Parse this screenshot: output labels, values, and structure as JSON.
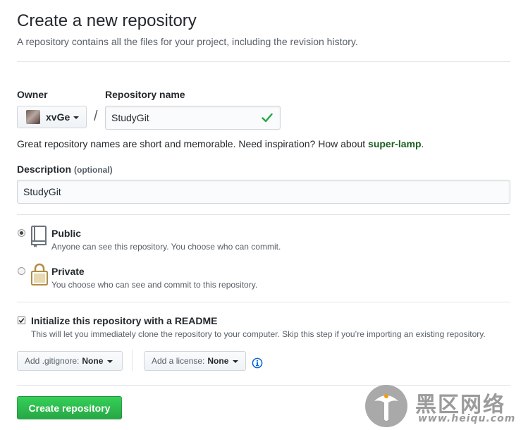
{
  "header": {
    "title": "Create a new repository",
    "subtitle": "A repository contains all the files for your project, including the revision history."
  },
  "owner": {
    "label": "Owner",
    "name": "xvGe"
  },
  "separator": "/",
  "repo_name": {
    "label": "Repository name",
    "value": "StudyGit",
    "valid": true
  },
  "hint": {
    "prefix": "Great repository names are short and memorable. Need inspiration? How about ",
    "suggestion": "super-lamp",
    "suffix": "."
  },
  "description": {
    "label": "Description",
    "optional": "(optional)",
    "value": "StudyGit"
  },
  "visibility": {
    "selected": "public",
    "public": {
      "title": "Public",
      "desc": "Anyone can see this repository. You choose who can commit."
    },
    "private": {
      "title": "Private",
      "desc": "You choose who can see and commit to this repository."
    }
  },
  "readme": {
    "checked": true,
    "title": "Initialize this repository with a README",
    "desc": "This will let you immediately clone the repository to your computer. Skip this step if you’re importing an existing repository."
  },
  "gitignore": {
    "label": "Add .gitignore:",
    "value": "None"
  },
  "license": {
    "label": "Add a license:",
    "value": "None"
  },
  "info_icon": "info-icon",
  "submit": {
    "label": "Create repository"
  },
  "watermark": {
    "text": "黑区网络",
    "url": "www.heiqu.com"
  },
  "colors": {
    "primary": "#28a745",
    "suggestion": "#1b5e20",
    "link": "#0366d6"
  }
}
